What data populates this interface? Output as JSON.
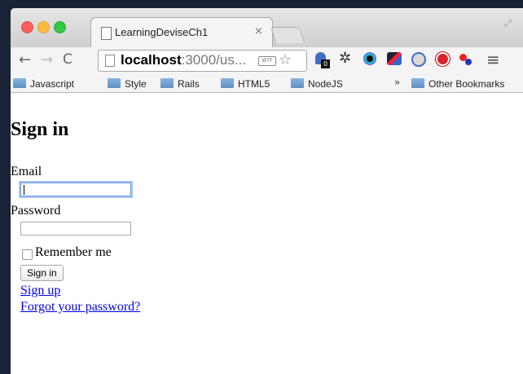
{
  "browser": {
    "tab_title": "LearningDeviseCh1",
    "tab_close": "×",
    "url_host": "localhost",
    "url_rest": ":3000/us...",
    "wtf_badge": "WTF",
    "ghost_badge": "0",
    "nav": {
      "back": "←",
      "forward": "→",
      "reload": "C",
      "star": "☆",
      "gear": "✲",
      "menu": "≡"
    }
  },
  "bookmarks": {
    "items": [
      {
        "label": "Javascript"
      },
      {
        "label": "Style"
      },
      {
        "label": "Rails"
      },
      {
        "label": "HTML5"
      },
      {
        "label": "NodeJS"
      }
    ],
    "more": "»",
    "other": "Other Bookmarks"
  },
  "page": {
    "title": "Sign in",
    "email_label": "Email",
    "email_value": "",
    "password_label": "Password",
    "password_value": "",
    "remember_label": "Remember me",
    "remember_checked": false,
    "submit_label": "Sign in",
    "signup_link": "Sign up",
    "forgot_link": "Forgot your password?"
  }
}
